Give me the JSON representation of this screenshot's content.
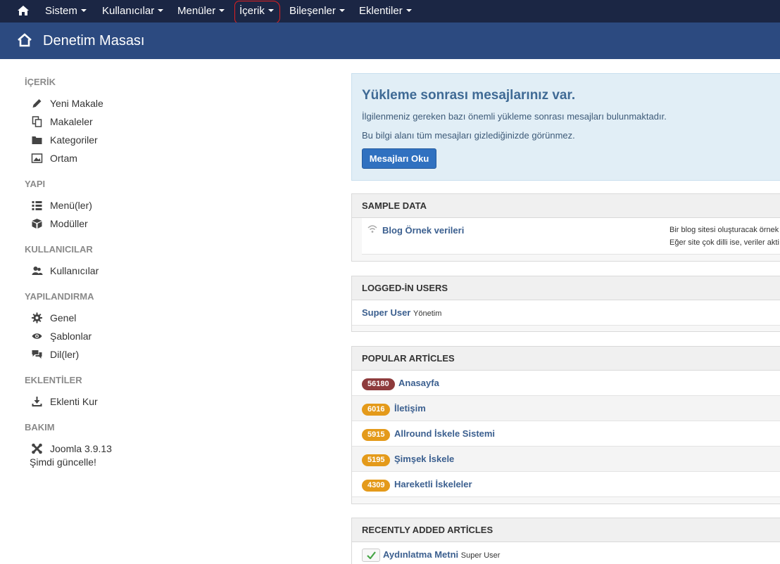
{
  "topnav": {
    "items": [
      {
        "label": "Sistem"
      },
      {
        "label": "Kullanıcılar"
      },
      {
        "label": "Menüler"
      },
      {
        "label": "İçerik"
      },
      {
        "label": "Bileşenler"
      },
      {
        "label": "Eklentiler"
      }
    ]
  },
  "header": {
    "title": "Denetim Masası"
  },
  "sidebar": {
    "sections": [
      {
        "title": "İÇERİK",
        "items": [
          {
            "label": "Yeni Makale",
            "icon": "pencil-icon"
          },
          {
            "label": "Makaleler",
            "icon": "copy-icon"
          },
          {
            "label": "Kategoriler",
            "icon": "folder-icon"
          },
          {
            "label": "Ortam",
            "icon": "image-icon"
          }
        ]
      },
      {
        "title": "YAPI",
        "items": [
          {
            "label": "Menü(ler)",
            "icon": "list-icon"
          },
          {
            "label": "Modüller",
            "icon": "cube-icon"
          }
        ]
      },
      {
        "title": "KULLANICILAR",
        "items": [
          {
            "label": "Kullanıcılar",
            "icon": "users-icon"
          }
        ]
      },
      {
        "title": "YAPILANDIRMA",
        "items": [
          {
            "label": "Genel",
            "icon": "gear-icon"
          },
          {
            "label": "Şablonlar",
            "icon": "eye-icon"
          },
          {
            "label": "Dil(ler)",
            "icon": "comments-icon"
          }
        ]
      },
      {
        "title": "EKLENTİLER",
        "items": [
          {
            "label": "Eklenti Kur",
            "icon": "download-icon"
          }
        ]
      },
      {
        "title": "BAKIM",
        "items": [
          {
            "label": "Joomla 3.9.13",
            "icon": "joomla-icon"
          }
        ]
      }
    ],
    "update_text": "Şimdi güncelle!"
  },
  "message": {
    "title": "Yükleme sonrası mesajlarınız var.",
    "line1": "İlgilenmeniz gereken bazı önemli yükleme sonrası mesajları bulunmaktadır.",
    "line2": "Bu bilgi alanı tüm mesajları gizlediğinizde görünmez.",
    "button": "Mesajları Oku"
  },
  "sample_data": {
    "heading": "SAMPLE DATA",
    "item_label": "Blog Örnek verileri",
    "desc1": "Bir blog sitesi oluşturacak örnek",
    "desc2": "Eğer site çok dilli ise, veriler akti"
  },
  "logged_in": {
    "heading": "LOGGED-İN USERS",
    "user": "Super User",
    "role": "Yönetim"
  },
  "popular": {
    "heading": "POPULAR ARTİCLES",
    "rows": [
      {
        "hits": "56180",
        "title": "Anasayfa",
        "color": "#8e3b3c"
      },
      {
        "hits": "6016",
        "title": "İletişim",
        "color": "#e49a1a"
      },
      {
        "hits": "5915",
        "title": "Allround İskele Sistemi",
        "color": "#e49a1a"
      },
      {
        "hits": "5195",
        "title": "Şimşek İskele",
        "color": "#e49a1a"
      },
      {
        "hits": "4309",
        "title": "Hareketli İskeleler",
        "color": "#e49a1a"
      }
    ]
  },
  "recent": {
    "heading": "RECENTLY ADDED ARTİCLES",
    "rows": [
      {
        "title": "Aydınlatma Metni",
        "author": "Super User"
      }
    ]
  },
  "colors": {
    "topnav": "#1b2644",
    "header": "#2c4a80",
    "link": "#3b5f8f",
    "annotation": "#e02020"
  }
}
